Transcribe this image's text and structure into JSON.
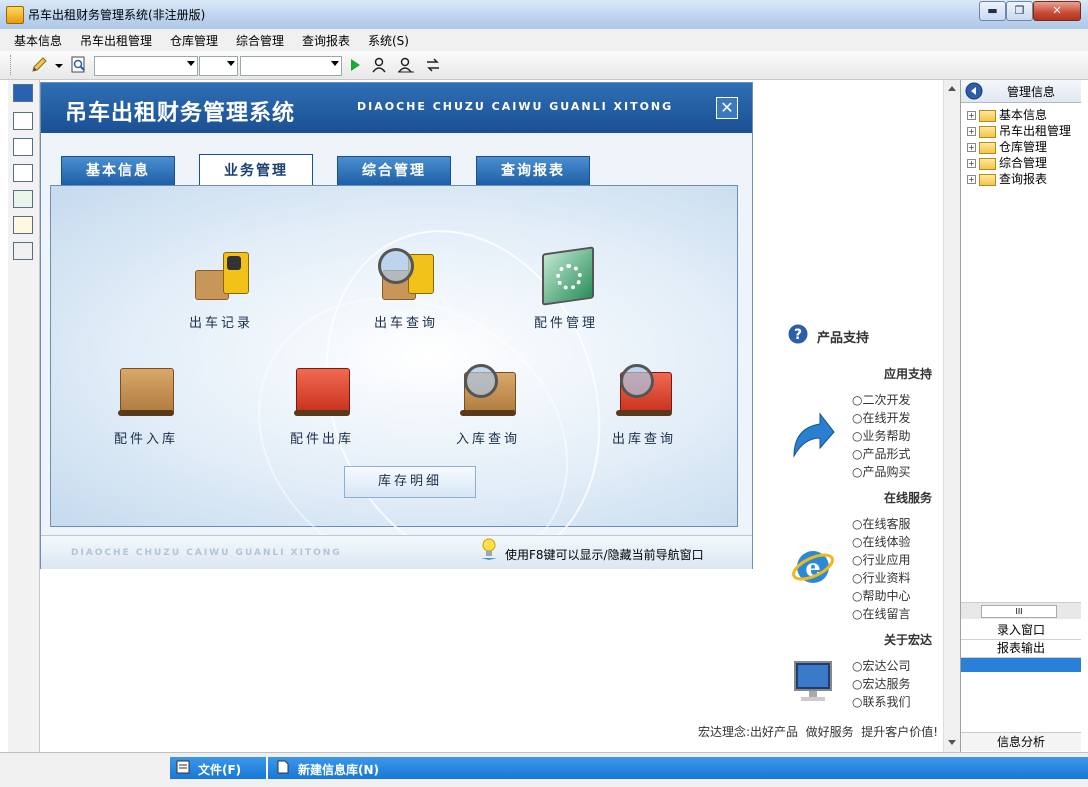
{
  "window": {
    "title": "吊车出租财务管理系统(非注册版)",
    "minimize": "▬",
    "maximize": "❐",
    "close": "✕"
  },
  "menu": [
    "基本信息",
    "吊车出租管理",
    "仓库管理",
    "综合管理",
    "查询报表",
    "系统(S)"
  ],
  "nav": {
    "title": "吊车出租财务管理系统",
    "subtitle": "DIAOCHE CHUZU CAIWU GUANLI XITONG",
    "close": "✕",
    "tabs": [
      "基本信息",
      "业务管理",
      "综合管理",
      "查询报表"
    ],
    "active_tab": "业务管理",
    "items": [
      {
        "label": "出车记录",
        "icon": "forklift-boxes-icon"
      },
      {
        "label": "出车查询",
        "icon": "forklift-search-icon"
      },
      {
        "label": "配件管理",
        "icon": "settings-screen-icon"
      },
      {
        "label": "配件入库",
        "icon": "boxes-pallet-icon"
      },
      {
        "label": "配件出库",
        "icon": "red-boxes-pallet-icon"
      },
      {
        "label": "入库查询",
        "icon": "boxes-search-icon"
      },
      {
        "label": "出库查询",
        "icon": "red-boxes-search-icon"
      }
    ],
    "stock_button": "库存明细",
    "footer_subtitle": "DIAOCHE CHUZU CAIWU GUANLI XITONG",
    "footer_hint": "使用F8键可以显示/隐藏当前导航窗口"
  },
  "support": {
    "title": "产品支持",
    "sections": [
      {
        "heading": "应用支持",
        "links": [
          "二次开发",
          "在线开发",
          "业务帮助",
          "产品形式",
          "产品购买"
        ]
      },
      {
        "heading": "在线服务",
        "links": [
          "在线客服",
          "在线体验",
          "行业应用",
          "行业资料",
          "帮助中心",
          "在线留言"
        ]
      },
      {
        "heading": "关于宏达",
        "links": [
          "宏达公司",
          "宏达服务",
          "联系我们"
        ]
      }
    ],
    "motto": "宏达理念:出好产品  做好服务  提升客户价值!"
  },
  "right_panel": {
    "title": "管理信息",
    "tree": [
      "基本信息",
      "吊车出租管理",
      "仓库管理",
      "综合管理",
      "查询报表"
    ],
    "scroll_label": "III",
    "tabs": [
      "录入窗口",
      "报表输出"
    ],
    "bottom_tab": "信息分析"
  },
  "status": {
    "file": "文件(F)",
    "new_db": "新建信息库(N)"
  },
  "colors": {
    "nav_header": "#1b4f93",
    "status_blue": "#1778d8",
    "accent_red": "#d83a2a"
  }
}
